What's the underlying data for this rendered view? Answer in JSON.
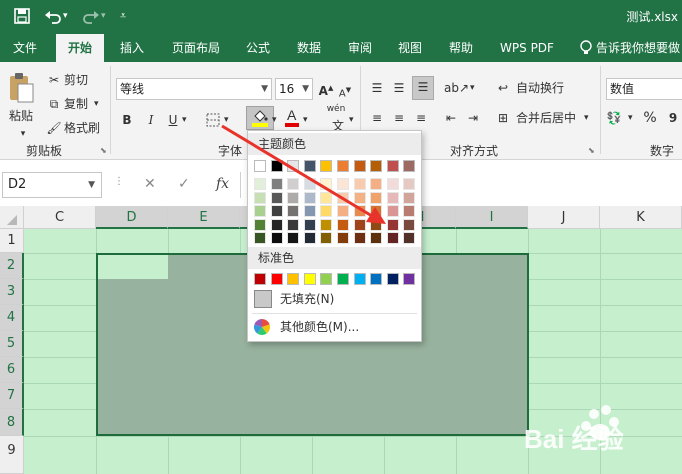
{
  "title_bar": {
    "filename": "测试.xlsx",
    "save_icon": "save-icon",
    "undo_icon": "undo-icon",
    "redo_icon": "redo-icon"
  },
  "tabs": [
    "文件",
    "开始",
    "插入",
    "页面布局",
    "公式",
    "数据",
    "审阅",
    "视图",
    "帮助",
    "WPS PDF",
    "告诉我你想要做"
  ],
  "active_tab": "开始",
  "ribbon": {
    "clipboard": {
      "paste": "粘贴",
      "cut": "剪切",
      "copy": "复制",
      "format_painter": "格式刷",
      "group": "剪贴板"
    },
    "font": {
      "name": "等线",
      "size": "16",
      "bold": "B",
      "italic": "I",
      "underline": "U",
      "group": "字体",
      "phonetic": "wén"
    },
    "alignment": {
      "wrap": "自动换行",
      "merge": "合并后居中",
      "group": "对齐方式"
    },
    "number": {
      "format": "数值",
      "percent": "%",
      "group": "数字"
    }
  },
  "formula_bar": {
    "cell_ref": "D2",
    "fx": "fx"
  },
  "columns": [
    "C",
    "D",
    "E",
    "F",
    "G",
    "H",
    "I",
    "J",
    "K"
  ],
  "rows": [
    "1",
    "2",
    "3",
    "4",
    "5",
    "6",
    "7",
    "8",
    "9"
  ],
  "fill_dropdown": {
    "theme_header": "主题颜色",
    "standard_header": "标准色",
    "no_fill": "无填充(N)",
    "more_colors": "其他颜色(M)...",
    "theme_top": [
      "#ffffff",
      "#000000",
      "#e7e6e6",
      "#44546a",
      "#ffc000",
      "#ed7d31",
      "#c55a11",
      "#b45f06",
      "#c0504d",
      "#9e6b63"
    ],
    "theme_shades": [
      [
        "#e2efda",
        "#7f7f7f",
        "#d0cece",
        "#d6dce4",
        "#fff2cc",
        "#fbe5d6",
        "#f8cbad",
        "#f4b084",
        "#f2dcdb",
        "#e6c9c3"
      ],
      [
        "#c6e0b4",
        "#595959",
        "#aeaaaa",
        "#adb9ca",
        "#ffe699",
        "#f8cbad",
        "#f4b183",
        "#f0a26b",
        "#e6b8b7",
        "#d2a59a"
      ],
      [
        "#a9d08e",
        "#404040",
        "#757171",
        "#8497b0",
        "#ffd966",
        "#f4b084",
        "#e88a4f",
        "#d4742f",
        "#da9694",
        "#b87d70"
      ],
      [
        "#548235",
        "#262626",
        "#3a3838",
        "#333f4f",
        "#bf8f00",
        "#c55a11",
        "#a0441b",
        "#8e4a15",
        "#963634",
        "#7a4a3f"
      ],
      [
        "#375623",
        "#0d0d0d",
        "#171616",
        "#222a35",
        "#806000",
        "#833c0c",
        "#6d2e12",
        "#5e310e",
        "#632523",
        "#52312a"
      ]
    ],
    "standard": [
      "#c00000",
      "#ff0000",
      "#ffc000",
      "#ffff00",
      "#92d050",
      "#00b050",
      "#00b0f0",
      "#0070c0",
      "#002060",
      "#7030a0"
    ]
  },
  "watermark": "Bai 经验"
}
